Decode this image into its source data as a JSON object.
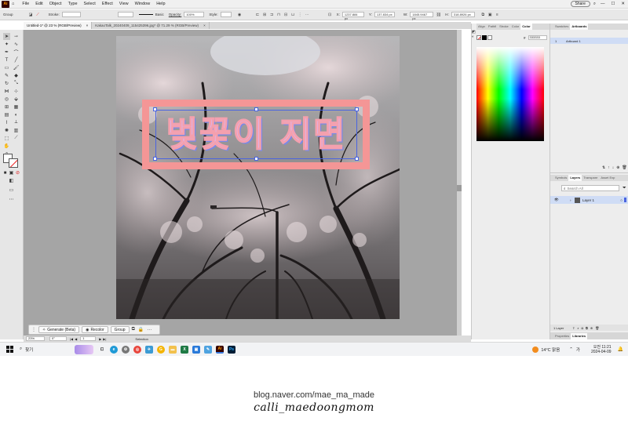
{
  "menubar": {
    "app_icon": "Ai",
    "items": [
      "File",
      "Edit",
      "Object",
      "Type",
      "Select",
      "Effect",
      "View",
      "Window",
      "Help"
    ],
    "share_label": "Share"
  },
  "controlbar": {
    "group_label": "Group",
    "stroke_label": "Stroke:",
    "basic_label": "Basic",
    "opacity_label": "Opacity:",
    "opacity_value": "100%",
    "style_label": "Style:",
    "x_value": "1237.884 px",
    "y_value": "137.834 px",
    "w_value": "1845.9467 px",
    "h_value": "318.8926 px"
  },
  "tabs": [
    {
      "label": "Untitled-1* @ 23 % (RGB/Preview)",
      "close": "×"
    },
    {
      "label": "KakaoTalk_20240409_115425396.jpg* @ 71.29 % (RGB/Preview)",
      "close": "×"
    }
  ],
  "artwork": {
    "text": "벚꽃이 지면",
    "frame_color": "#f49696",
    "text_fill": "#d8b8f5",
    "text_stroke": "#f4a0ae",
    "selection_color": "#4a64e0"
  },
  "context_bar": {
    "generate_label": "Generate (Beta)",
    "recolor_label": "Recolor",
    "group_label": "Group",
    "more_label": "···"
  },
  "statusbar": {
    "zoom": "23%",
    "rotation": "0°",
    "artboard_num": "1",
    "tool_name": "Selection"
  },
  "color_panel": {
    "tabs": [
      "Align",
      "Pathfi",
      "Stroke",
      "Color",
      "Color"
    ],
    "hex_prefix": "#",
    "hex_value": "333333"
  },
  "artboards_panel": {
    "tabs": [
      "Swatches",
      "Artboards"
    ],
    "items": [
      {
        "num": "1",
        "name": "Artboard 1"
      }
    ]
  },
  "layers_panel": {
    "tabs": [
      "Symbols",
      "Layers",
      "Transpare",
      "Asset Exp"
    ],
    "search_placeholder": "Search All",
    "layers": [
      {
        "name": "Layer 1"
      }
    ],
    "footer_count": "1 Layer",
    "bottom_tabs": [
      "Properties",
      "Libraries"
    ]
  },
  "taskbar": {
    "search_label": "찾기",
    "weather": "14°C 맑음",
    "ime": "가",
    "time": "오전 11:21",
    "date": "2024-04-09"
  },
  "footer": {
    "url": "blog.naver.com/mae_ma_made",
    "signature": "calli_maedoongmom"
  }
}
